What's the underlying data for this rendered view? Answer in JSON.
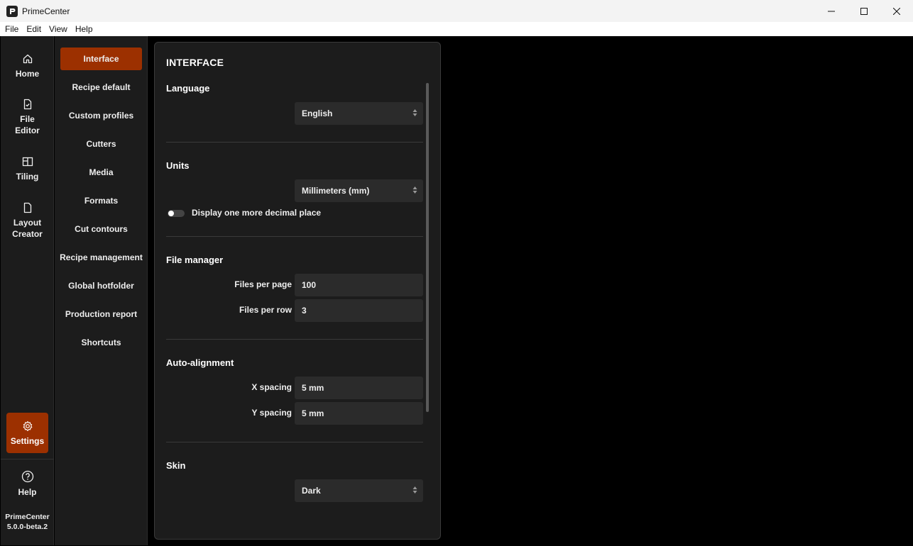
{
  "window": {
    "title": "PrimeCenter"
  },
  "menu": [
    "File",
    "Edit",
    "View",
    "Help"
  ],
  "rail": {
    "home": "Home",
    "file_editor": [
      "File",
      "Editor"
    ],
    "tiling": "Tiling",
    "layout_creator": [
      "Layout",
      "Creator"
    ],
    "settings": "Settings",
    "help": "Help",
    "version": [
      "PrimeCenter",
      "5.0.0-beta.2"
    ]
  },
  "categories": [
    "Interface",
    "Recipe default",
    "Custom profiles",
    "Cutters",
    "Media",
    "Formats",
    "Cut contours",
    "Recipe management",
    "Global hotfolder",
    "Production report",
    "Shortcuts"
  ],
  "panel": {
    "title": "INTERFACE",
    "language": {
      "title": "Language",
      "value": "English"
    },
    "units": {
      "title": "Units",
      "value": "Millimeters (mm)",
      "toggle_label": "Display one more decimal place",
      "toggle_on": false
    },
    "file_manager": {
      "title": "File manager",
      "files_per_page_label": "Files per page",
      "files_per_page": "100",
      "files_per_row_label": "Files per row",
      "files_per_row": "3"
    },
    "auto_alignment": {
      "title": "Auto-alignment",
      "x_label": "X spacing",
      "x_value": "5 mm",
      "y_label": "Y spacing",
      "y_value": "5 mm"
    },
    "skin": {
      "title": "Skin",
      "value": "Dark"
    }
  },
  "colors": {
    "accent": "#9c3000",
    "background": "#000000",
    "panel": "#1c1c1c",
    "field": "#2b2b2b"
  }
}
